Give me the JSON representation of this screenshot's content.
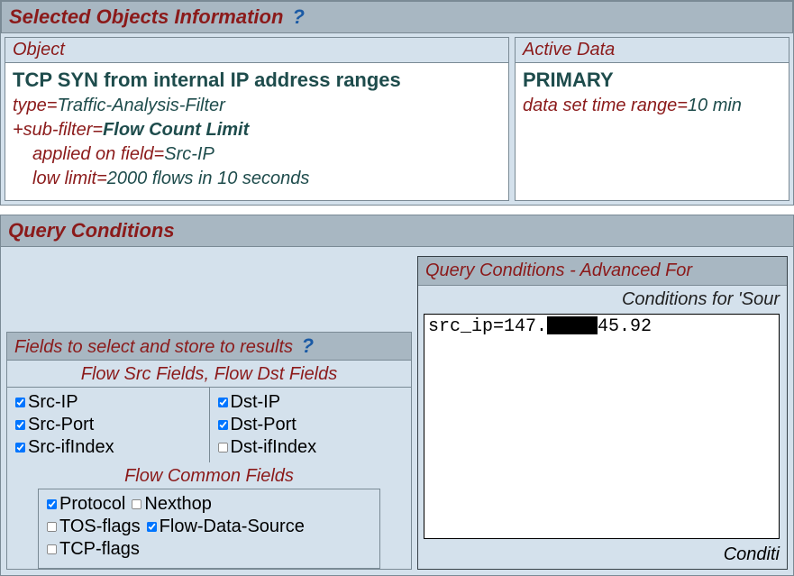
{
  "selected": {
    "title": "Selected Objects Information",
    "help": "?",
    "object_header": "Object",
    "active_header": "Active Data",
    "object": {
      "name": "TCP SYN from internal IP address ranges",
      "type_label": "type=",
      "type_value": "Traffic-Analysis-Filter",
      "subfilter_label": "+sub-filter=",
      "subfilter_value": "Flow Count Limit",
      "applied_label": "applied on field=",
      "applied_value": "Src-IP",
      "lowlimit_label": "low limit=",
      "lowlimit_value": "2000 flows in 10 seconds"
    },
    "active": {
      "primary": "PRIMARY",
      "range_label": "data set time range=",
      "range_value": "10 min"
    }
  },
  "qc": {
    "title": "Query Conditions",
    "fields": {
      "header": "Fields to select and store to results",
      "help": "?",
      "src_title": "Flow Src Fields",
      "sep": ", ",
      "dst_title": "Flow Dst Fields",
      "common_title": "Flow Common Fields",
      "src": [
        {
          "label": "Src-IP",
          "checked": true
        },
        {
          "label": "Src-Port",
          "checked": true
        },
        {
          "label": "Src-ifIndex",
          "checked": true
        }
      ],
      "dst": [
        {
          "label": "Dst-IP",
          "checked": true
        },
        {
          "label": "Dst-Port",
          "checked": true
        },
        {
          "label": "Dst-ifIndex",
          "checked": false
        }
      ],
      "common": [
        {
          "label": "Protocol",
          "checked": true
        },
        {
          "label": "Nexthop",
          "checked": false
        },
        {
          "label": "TOS-flags",
          "checked": false
        },
        {
          "label": "Flow-Data-Source",
          "checked": true
        },
        {
          "label": "TCP-flags",
          "checked": false
        }
      ]
    },
    "advanced": {
      "title": "Query Conditions - Advanced For",
      "sub": "Conditions for 'Sour",
      "text_prefix": "src_ip=147.",
      "text_suffix": "45.92",
      "footer": "Conditi"
    }
  }
}
